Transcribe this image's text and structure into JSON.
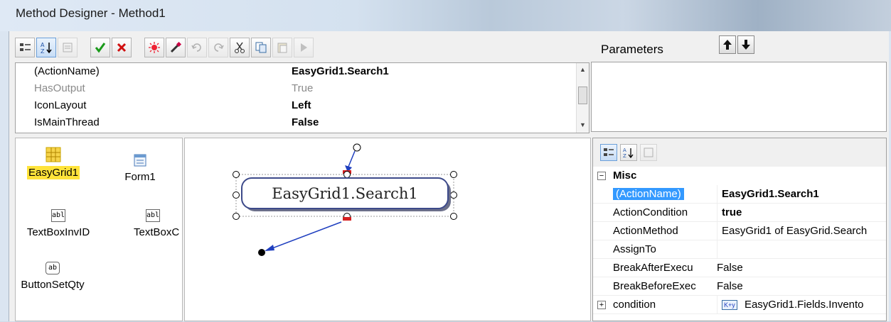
{
  "window": {
    "title": "Method Designer - Method1"
  },
  "toolbar": {
    "icons": [
      "categorized-icon",
      "alphabetical-icon",
      "property-pages-icon",
      "accept-icon",
      "cancel-icon",
      "debug-icon",
      "wand-icon",
      "undo-icon",
      "redo-icon",
      "cut-icon",
      "copy-icon",
      "paste-icon",
      "run-icon"
    ]
  },
  "properties": {
    "rows": [
      {
        "name": "(ActionName)",
        "value": "EasyGrid1.Search1"
      },
      {
        "name": "HasOutput",
        "value": "True"
      },
      {
        "name": "IconLayout",
        "value": "Left"
      },
      {
        "name": "IsMainThread",
        "value": "False"
      }
    ]
  },
  "parameters": {
    "label": "Parameters"
  },
  "toolbox": {
    "items": [
      {
        "label": "EasyGrid1",
        "icon": "grid-icon"
      },
      {
        "label": "Form1",
        "icon": "form-icon"
      },
      {
        "label": "TextBoxInvID",
        "icon": "textbox-icon",
        "icon_text": "abl"
      },
      {
        "label": "TextBoxC",
        "icon": "textbox-icon",
        "icon_text": "abl"
      },
      {
        "label": "ButtonSetQty",
        "icon": "button-icon",
        "icon_text": "ab"
      }
    ]
  },
  "canvas": {
    "action_label": "EasyGrid1.Search1"
  },
  "right_props": {
    "category": "Misc",
    "rows": [
      {
        "name": "(ActionName)",
        "value": "EasyGrid1.Search1"
      },
      {
        "name": "ActionCondition",
        "value": "true"
      },
      {
        "name": "ActionMethod",
        "value": "EasyGrid1 of EasyGrid.Search"
      },
      {
        "name": "AssignTo",
        "value": ""
      },
      {
        "name": "BreakAfterExecu",
        "value": "False"
      },
      {
        "name": "BreakBeforeExec",
        "value": "False"
      },
      {
        "name": "condition",
        "value": "EasyGrid1.Fields.Invento",
        "value_icon": "K+y"
      }
    ]
  },
  "colors": {
    "selection": "#3399ff",
    "highlight": "#ffe33a",
    "link_line": "#1f3fbf",
    "link_head": "#d62020"
  }
}
